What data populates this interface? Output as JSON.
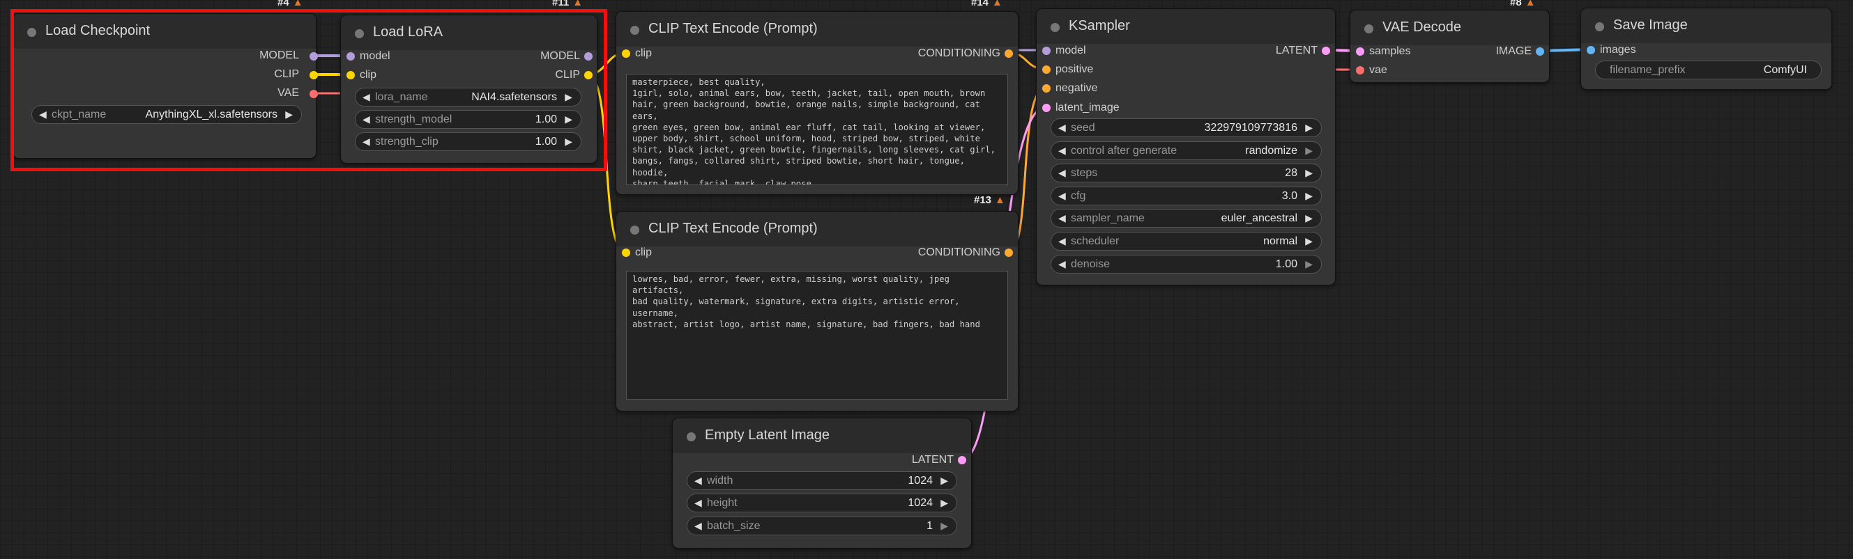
{
  "colors": {
    "model": "#b39ddb",
    "clip": "#ffd500",
    "vae": "#ff6e6e",
    "conditioning": "#ffa931",
    "latent": "#ff9cf9",
    "image": "#64b5f6",
    "highlight": "#f01010"
  },
  "nodes": {
    "load_checkpoint": {
      "badge": "#4",
      "title": "Load Checkpoint",
      "outputs": [
        "MODEL",
        "CLIP",
        "VAE"
      ],
      "ckpt_name": {
        "name": "ckpt_name",
        "value": "AnythingXL_xl.safetensors"
      }
    },
    "load_lora": {
      "badge": "#11",
      "title": "Load LoRA",
      "inputs": [
        "model",
        "clip"
      ],
      "outputs": [
        "MODEL",
        "CLIP"
      ],
      "lora_name": {
        "name": "lora_name",
        "value": "NAI4.safetensors"
      },
      "strength_model": {
        "name": "strength_model",
        "value": "1.00"
      },
      "strength_clip": {
        "name": "strength_clip",
        "value": "1.00"
      }
    },
    "clip_positive": {
      "badge": "#14",
      "title": "CLIP Text Encode (Prompt)",
      "input": "clip",
      "output": "CONDITIONING",
      "text": "masterpiece, best quality,\n1girl, solo, animal ears, bow, teeth, jacket, tail, open mouth, brown\nhair, green background, bowtie, orange nails, simple background, cat ears,\ngreen eyes, green bow, animal ear fluff, cat tail, looking at viewer,\nupper body, shirt, school uniform, hood, striped bow, striped, white\nshirt, black jacket, green bowtie, fingernails, long sleeves, cat girl,\nbangs, fangs, collared shirt, striped bowtie, short hair, tongue, hoodie,\nsharp teeth, facial mark, claw pose"
    },
    "clip_negative": {
      "badge": "#13",
      "title": "CLIP Text Encode (Prompt)",
      "input": "clip",
      "output": "CONDITIONING",
      "text": "lowres, bad, error, fewer, extra, missing, worst quality, jpeg artifacts,\nbad quality, watermark, signature, extra digits, artistic error, username,\nabstract, artist logo, artist name, signature, bad fingers, bad hand"
    },
    "ksampler": {
      "title": "KSampler",
      "inputs": [
        "model",
        "positive",
        "negative",
        "latent_image"
      ],
      "output": "LATENT",
      "widgets": [
        {
          "name": "seed",
          "value": "322979109773816",
          "dim": false
        },
        {
          "name": "control after generate",
          "value": "randomize",
          "dim": true
        },
        {
          "name": "steps",
          "value": "28",
          "dim": false
        },
        {
          "name": "cfg",
          "value": "3.0",
          "dim": false
        },
        {
          "name": "sampler_name",
          "value": "euler_ancestral",
          "dim": false
        },
        {
          "name": "scheduler",
          "value": "normal",
          "dim": false
        },
        {
          "name": "denoise",
          "value": "1.00",
          "dim": true
        }
      ]
    },
    "vae_decode": {
      "badge": "#8",
      "title": "VAE Decode",
      "inputs": [
        "samples",
        "vae"
      ],
      "output": "IMAGE"
    },
    "save_image": {
      "title": "Save Image",
      "input": "images",
      "filename_prefix": {
        "name": "filename_prefix",
        "value": "ComfyUI"
      }
    },
    "empty_latent": {
      "title": "Empty Latent Image",
      "output": "LATENT",
      "widgets": [
        {
          "name": "width",
          "value": "1024",
          "dim": false
        },
        {
          "name": "height",
          "value": "1024",
          "dim": false
        },
        {
          "name": "batch_size",
          "value": "1",
          "dim": true
        }
      ]
    }
  },
  "icons": {
    "collapse": "circle-dot",
    "left": "◀",
    "right": "▶",
    "badge": "fox-icon"
  }
}
